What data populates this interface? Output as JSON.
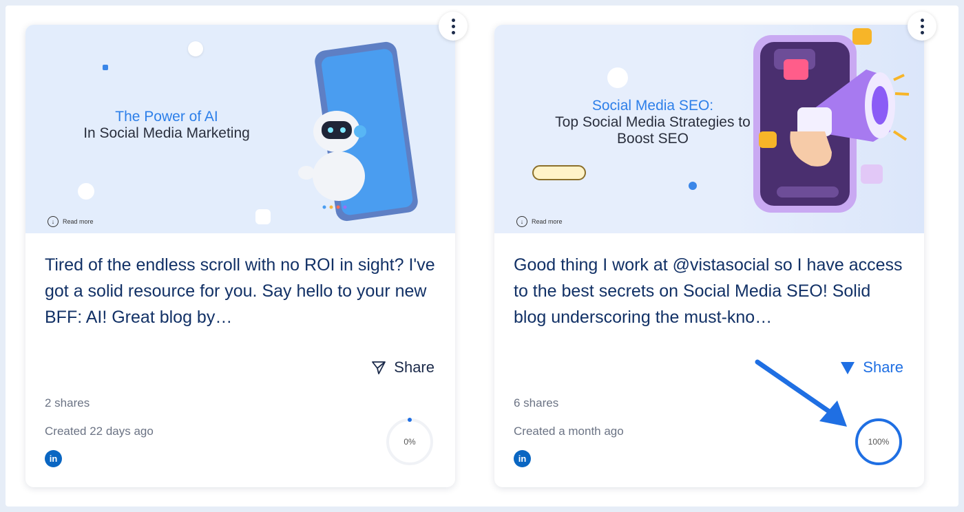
{
  "cards": [
    {
      "thumb_accent": "The  Power of AI",
      "thumb_title": "In Social Media Marketing",
      "read_more": "Read more",
      "text": "Tired of the endless scroll with no ROI in sight? I've got a solid resource for you. Say hello to your new BFF: AI! Great blog by…",
      "share_label": "Share",
      "shares": "2 shares",
      "created": "Created 22 days ago",
      "network_icon": "linkedin-icon",
      "network_label": "in",
      "progress_label": "0%",
      "progress": 0
    },
    {
      "thumb_accent": "Social Media SEO:",
      "thumb_title": "Top Social Media Strategies to Boost SEO",
      "read_more": "Read more",
      "text": "Good thing I work at @vistasocial so I have access to the best secrets on Social Media SEO! Solid blog underscoring the must-kno…",
      "share_label": "Share",
      "shares": "6 shares",
      "created": "Created a month ago",
      "network_icon": "linkedin-icon",
      "network_label": "in",
      "progress_label": "100%",
      "progress": 1
    }
  ],
  "colors": {
    "accent": "#1f6fe3",
    "text_dark": "#123166",
    "muted": "#6b7384",
    "linkedin": "#0a66c2"
  }
}
